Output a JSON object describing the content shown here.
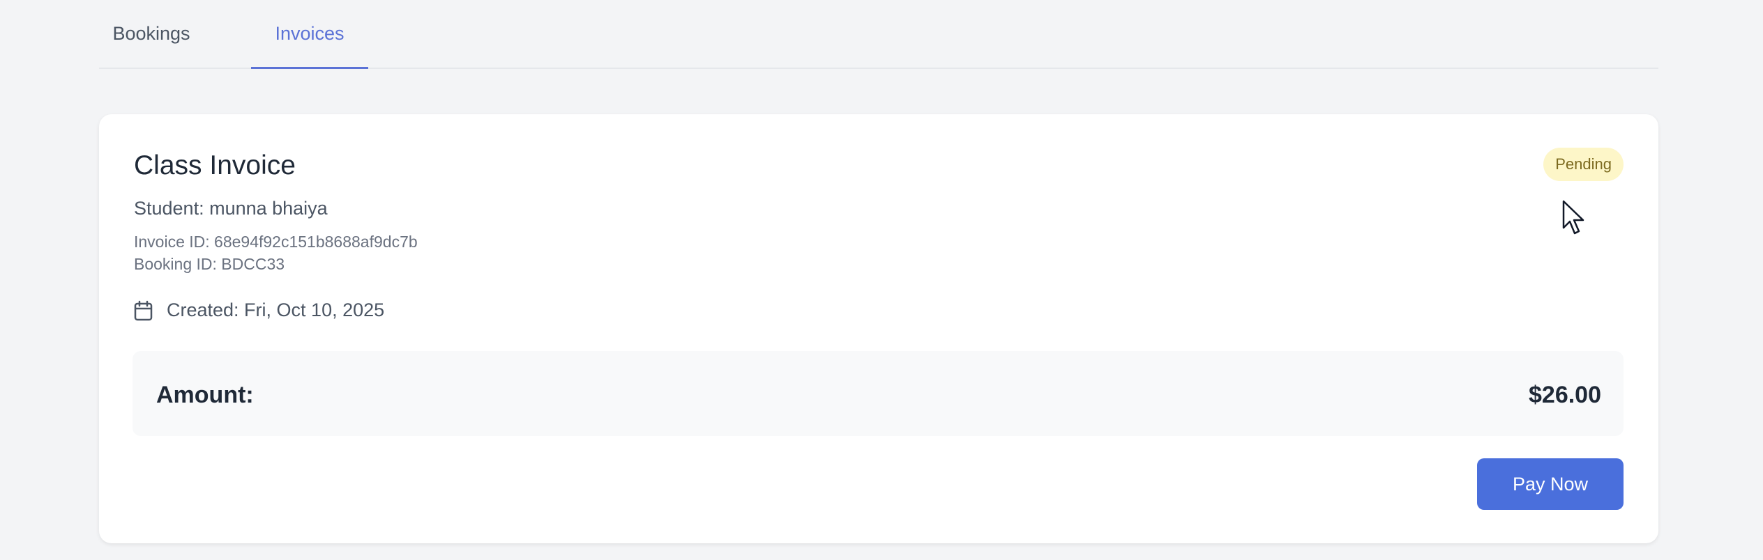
{
  "tabs": [
    {
      "label": "Bookings",
      "active": false
    },
    {
      "label": "Invoices",
      "active": true
    }
  ],
  "invoice": {
    "title": "Class Invoice",
    "student": "Student: munna bhaiya",
    "invoice_id": "Invoice ID: 68e94f92c151b8688af9dc7b",
    "booking_id": "Booking ID: BDCC33",
    "created": "Created: Fri, Oct 10, 2025",
    "status": "Pending",
    "amount_label": "Amount:",
    "amount_value": "$26.00",
    "pay_label": "Pay Now"
  },
  "icons": {
    "created": "calendar-icon",
    "cursor": "mouse-cursor-icon"
  },
  "colors": {
    "accent": "#5b72d6",
    "button": "#4a6fdc",
    "badge_bg": "#fdf6c8",
    "badge_text": "#7c6a1f",
    "page_bg": "#f3f4f6",
    "panel_bg": "#f8f9fa"
  }
}
